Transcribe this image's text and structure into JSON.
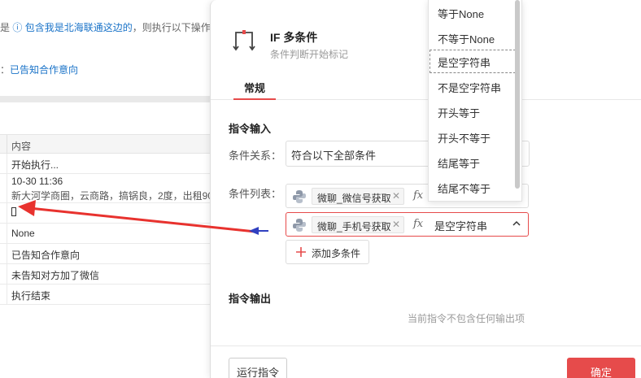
{
  "background": {
    "line1_prefix": "是",
    "line1_link": "包含我是北海联通这边的",
    "line1_suffix": "，则执行以下操作",
    "line2_prefix": "：",
    "line2_link": "已告知合作意向",
    "table_header": "内容",
    "rows": {
      "r0": "开始执行...",
      "r1_time": "10-30 11:36",
      "r1_text": "新大河学商圈，云商路，搞锅良，2度，出租90",
      "r3": "None",
      "r4": "已告知合作意向",
      "r5": "未告知对方加了微信",
      "r6": "执行结束"
    }
  },
  "modal": {
    "title": "IF 多条件",
    "subtitle": "条件判断开始标记",
    "tab_general": "常规",
    "section_input": "指令输入",
    "label_relation": "条件关系：",
    "relation_value": "符合以下全部条件",
    "label_list": "条件列表：",
    "conditions": [
      {
        "variable": "微聊_微信号获取",
        "operator": ""
      },
      {
        "variable": "微聊_手机号获取",
        "operator": "是空字符串"
      }
    ],
    "add_condition": "添加多条件",
    "section_output": "指令输出",
    "no_output": "当前指令不包含任何输出项",
    "run_button": "运行指令",
    "confirm_button": "确定"
  },
  "dropdown": {
    "options": [
      "等于None",
      "不等于None",
      "是空字符串",
      "不是空字符串",
      "开头等于",
      "开头不等于",
      "结尾等于",
      "结尾不等于"
    ],
    "selected": "是空字符串"
  },
  "icons": {
    "modal": "branch-icon",
    "variable": "python-icon",
    "expression": "fx-icon",
    "remove": "close-icon",
    "collapse": "chevron-up-icon",
    "add": "plus-icon"
  },
  "colors": {
    "accent": "#e64b4b",
    "link": "#1a73c8",
    "arrow_red": "#e8322e",
    "arrow_blue": "#3040c0"
  }
}
